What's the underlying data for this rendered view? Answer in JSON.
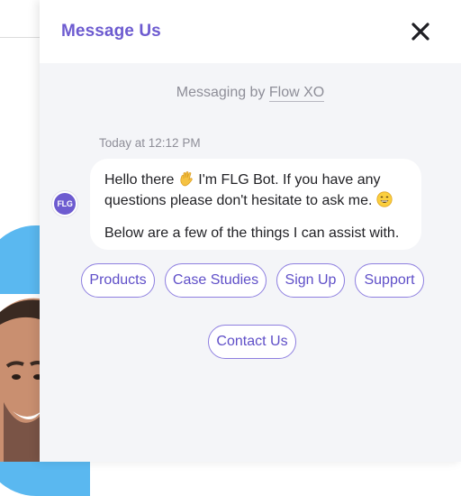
{
  "header": {
    "title": "Message Us",
    "close_icon": "close-icon"
  },
  "branding": {
    "prefix": "Messaging by ",
    "brand": "Flow XO"
  },
  "conversation": {
    "timestamp": "Today at 12:12 PM",
    "bot_avatar_text": "FLG",
    "message": {
      "line1_before_emoji": "Hello there ",
      "line1_after_emoji": " I'm FLG Bot. If you have any questions please don't hesitate to ask me. ",
      "line2": "Below are a few of the things I can assist with.",
      "emoji_wave": "waving-hand-icon",
      "emoji_smile": "grinning-face-icon"
    }
  },
  "quick_replies": [
    "Products",
    "Case Studies",
    "Sign Up",
    "Support",
    "Contact Us"
  ],
  "colors": {
    "accent": "#6d5bd0",
    "panel_bg": "#f4f5f8",
    "button_border": "#8e7fe0",
    "background_blob": "#5ab8f0"
  }
}
